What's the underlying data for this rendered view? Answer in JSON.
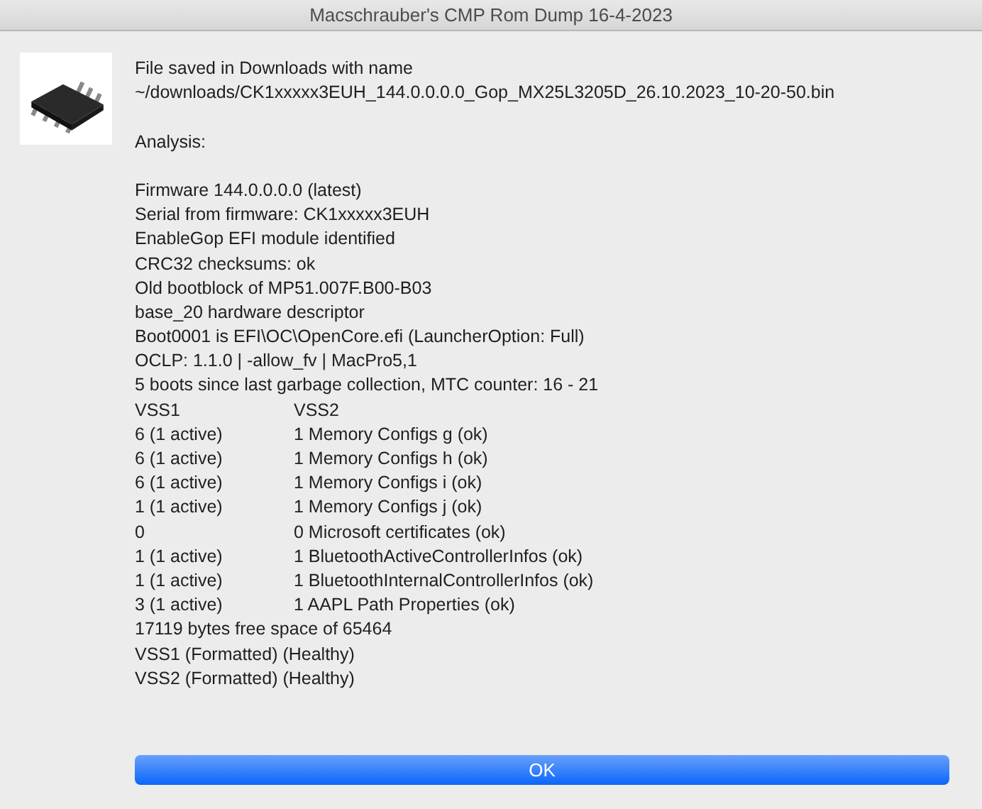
{
  "window": {
    "title": "Macschrauber's CMP Rom Dump 16-4-2023"
  },
  "file_saved": [
    "File saved in Downloads with name",
    "~/downloads/CK1xxxxx3EUH_144.0.0.0.0_Gop_MX25L3205D_26.10.2023_10-20-50.bin"
  ],
  "analysis_label": "Analysis:",
  "details": [
    "Firmware 144.0.0.0.0 (latest)",
    "Serial from firmware: CK1xxxxx3EUH",
    "EnableGop EFI module identified",
    "CRC32 checksums: ok",
    "Old bootblock of MP51.007F.B00-B03",
    "base_20 hardware descriptor",
    "Boot0001 is EFI\\OC\\OpenCore.efi (LauncherOption: Full)",
    "OCLP: 1.1.0 | -allow_fv | MacPro5,1",
    "5 boots since last garbage collection, MTC counter: 16 - 21"
  ],
  "vss_table": {
    "columns": [
      "VSS1",
      "VSS2"
    ],
    "rows": [
      [
        "6 (1 active)",
        "1 Memory Configs g (ok)"
      ],
      [
        "6 (1 active)",
        "1 Memory Configs h (ok)"
      ],
      [
        "6 (1 active)",
        "1 Memory Configs i (ok)"
      ],
      [
        "1 (1 active)",
        "1 Memory Configs j (ok)"
      ],
      [
        "0",
        "0 Microsoft certificates (ok)"
      ],
      [
        "1 (1 active)",
        "1 BluetoothActiveControllerInfos (ok)"
      ],
      [
        "1 (1 active)",
        "1 BluetoothInternalControllerInfos (ok)"
      ],
      [
        "3 (1 active)",
        "1 AAPL Path Properties (ok)"
      ]
    ]
  },
  "summary": [
    "17119 bytes free space of 65464",
    "VSS1 (Formatted) (Healthy)",
    "VSS2 (Formatted) (Healthy)"
  ],
  "buttons": [
    "OK"
  ]
}
